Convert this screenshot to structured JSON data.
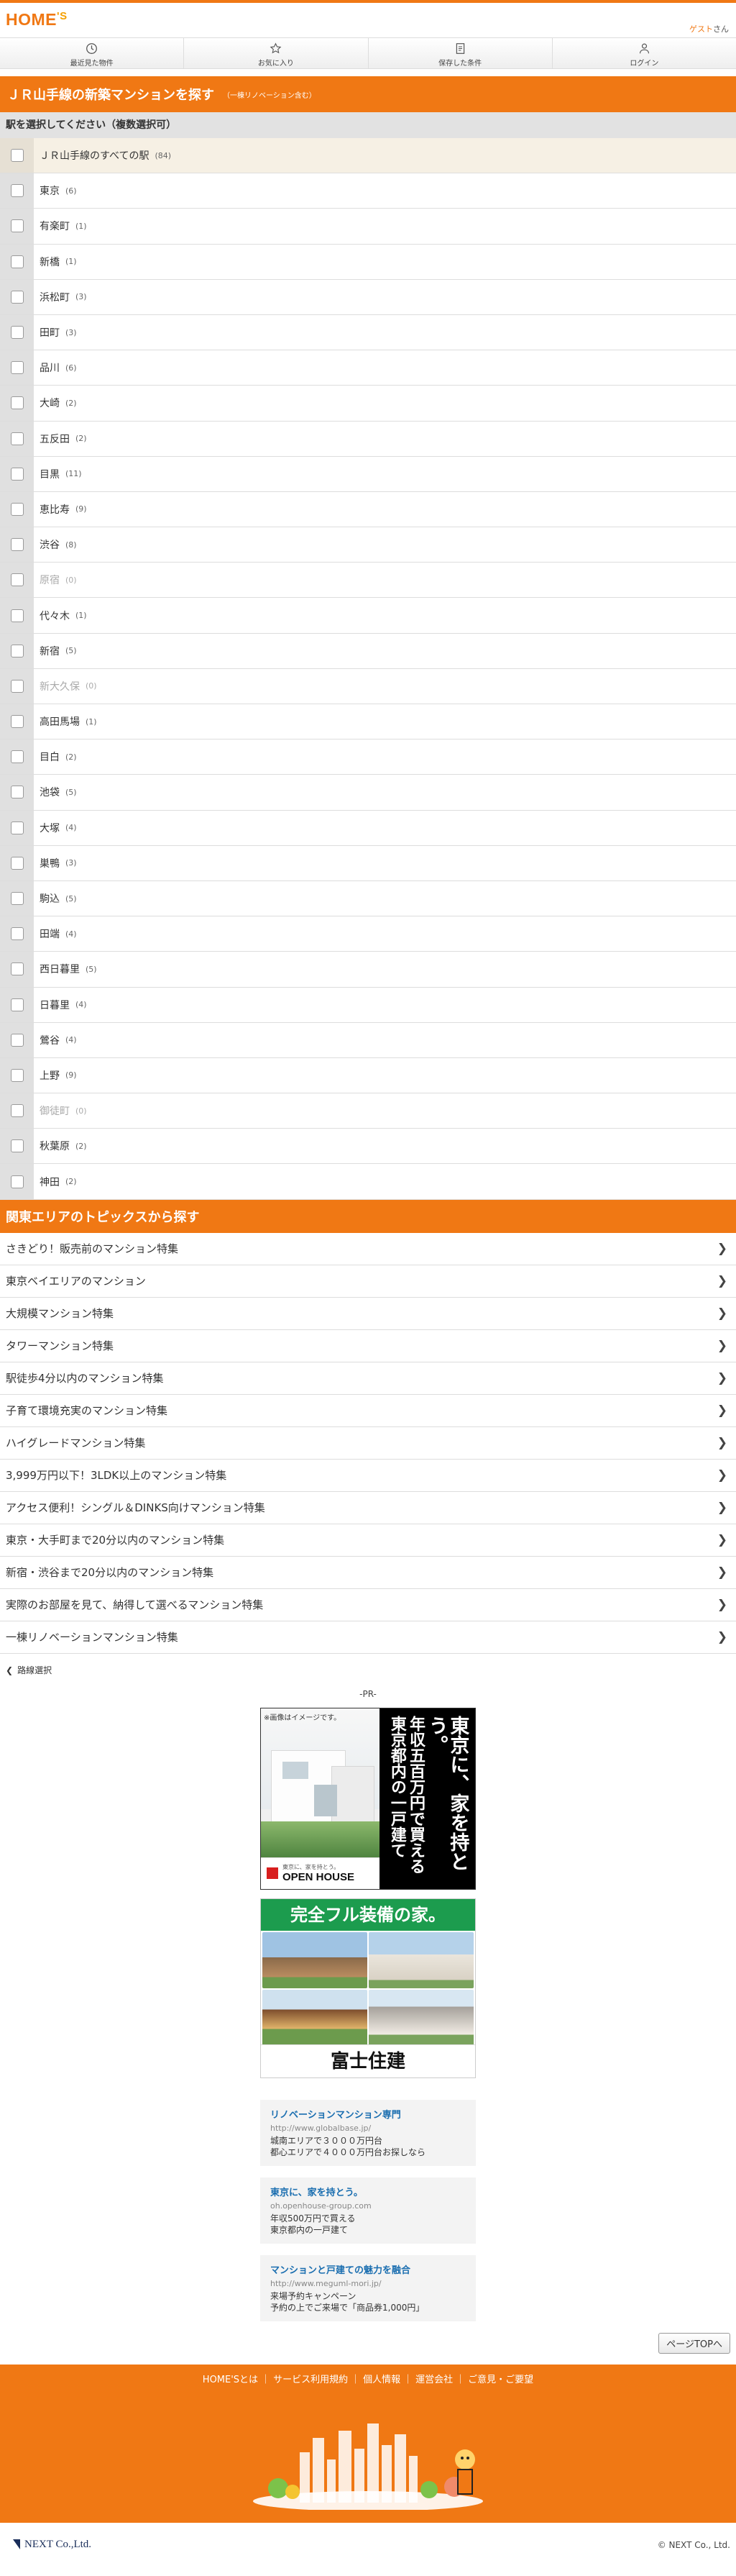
{
  "header": {
    "logo_main": "HOME",
    "logo_apos": "'S",
    "user_name": "ゲスト",
    "user_suffix": "さん"
  },
  "nav": [
    {
      "label": "最近見た物件",
      "icon": "clock-icon"
    },
    {
      "label": "お気に入り",
      "icon": "star-icon"
    },
    {
      "label": "保存した条件",
      "icon": "memo-icon"
    },
    {
      "label": "ログイン",
      "icon": "person-icon"
    }
  ],
  "title": {
    "text": "ＪＲ山手線の新築マンションを探す",
    "note": "（一棟リノベーション含む）"
  },
  "instruction": "駅を選択してください（複数選択可）",
  "stations": [
    {
      "name": "ＪＲ山手線のすべての駅",
      "count": "(84)"
    },
    {
      "name": "東京",
      "count": "(6)"
    },
    {
      "name": "有楽町",
      "count": "(1)"
    },
    {
      "name": "新橋",
      "count": "(1)"
    },
    {
      "name": "浜松町",
      "count": "(3)"
    },
    {
      "name": "田町",
      "count": "(3)"
    },
    {
      "name": "品川",
      "count": "(6)"
    },
    {
      "name": "大崎",
      "count": "(2)"
    },
    {
      "name": "五反田",
      "count": "(2)"
    },
    {
      "name": "目黒",
      "count": "(11)"
    },
    {
      "name": "恵比寿",
      "count": "(9)"
    },
    {
      "name": "渋谷",
      "count": "(8)"
    },
    {
      "name": "原宿",
      "count": "(0)"
    },
    {
      "name": "代々木",
      "count": "(1)"
    },
    {
      "name": "新宿",
      "count": "(5)"
    },
    {
      "name": "新大久保",
      "count": "(0)"
    },
    {
      "name": "高田馬場",
      "count": "(1)"
    },
    {
      "name": "目白",
      "count": "(2)"
    },
    {
      "name": "池袋",
      "count": "(5)"
    },
    {
      "name": "大塚",
      "count": "(4)"
    },
    {
      "name": "巣鴨",
      "count": "(3)"
    },
    {
      "name": "駒込",
      "count": "(5)"
    },
    {
      "name": "田端",
      "count": "(4)"
    },
    {
      "name": "西日暮里",
      "count": "(5)"
    },
    {
      "name": "日暮里",
      "count": "(4)"
    },
    {
      "name": "鶯谷",
      "count": "(4)"
    },
    {
      "name": "上野",
      "count": "(9)"
    },
    {
      "name": "御徒町",
      "count": "(0)"
    },
    {
      "name": "秋葉原",
      "count": "(2)"
    },
    {
      "name": "神田",
      "count": "(2)"
    }
  ],
  "topics_title": "関東エリアのトピックスから探す",
  "topics": [
    "さきどり！販売前のマンション特集",
    "東京ベイエリアのマンション",
    "大規模マンション特集",
    "タワーマンション特集",
    "駅徒歩4分以内のマンション特集",
    "子育て環境充実のマンション特集",
    "ハイグレードマンション特集",
    "3,999万円以下！3LDK以上のマンション特集",
    "アクセス便利！シングル＆DINKS向けマンション特集",
    "東京・大手町まで20分以内のマンション特集",
    "新宿・渋谷まで20分以内のマンション特集",
    "実際のお部屋を見て、納得して選べるマンション特集",
    "一棟リノベーションマンション特集"
  ],
  "back_label": "路線選択",
  "pr_label": "-PR-",
  "ad1": {
    "note": "※画像はイメージです。",
    "lines": [
      "東京に、家を持とう。",
      "年収五百万円で買える",
      "東京都内の一戸建て"
    ],
    "brand_small": "東京に、家を持とう。",
    "brand": "OPEN HOUSE"
  },
  "ad2": {
    "head": "完全フル装備の家。",
    "foot": "富士住建"
  },
  "text_ads": [
    {
      "title": "リノベーションマンション専門",
      "url": "http://www.globalbase.jp/",
      "desc": [
        "城南エリアで３０００万円台",
        "都心エリアで４０００万円台お探しなら"
      ]
    },
    {
      "title": "東京に、家を持とう。",
      "url": "oh.openhouse-group.com",
      "desc": [
        "年収500万円で買える",
        "東京都内の一戸建て"
      ]
    },
    {
      "title": "マンションと戸建ての魅力を融合",
      "url": "http://www.meguml-mori.jp/",
      "desc": [
        "来場予約キャンペーン",
        "予約の上でご来場で「商品券1,000円」"
      ]
    }
  ],
  "pagetop": "ページTOPへ",
  "footer_links": [
    "HOME'Sとは",
    "サービス利用規約",
    "個人情報",
    "運営会社",
    "ご意見・ご要望"
  ],
  "company": "NEXT Co.,Ltd.",
  "copyright": "© NEXT Co., Ltd.",
  "colors": {
    "accent": "#f07814",
    "link": "#1a6eb0"
  }
}
